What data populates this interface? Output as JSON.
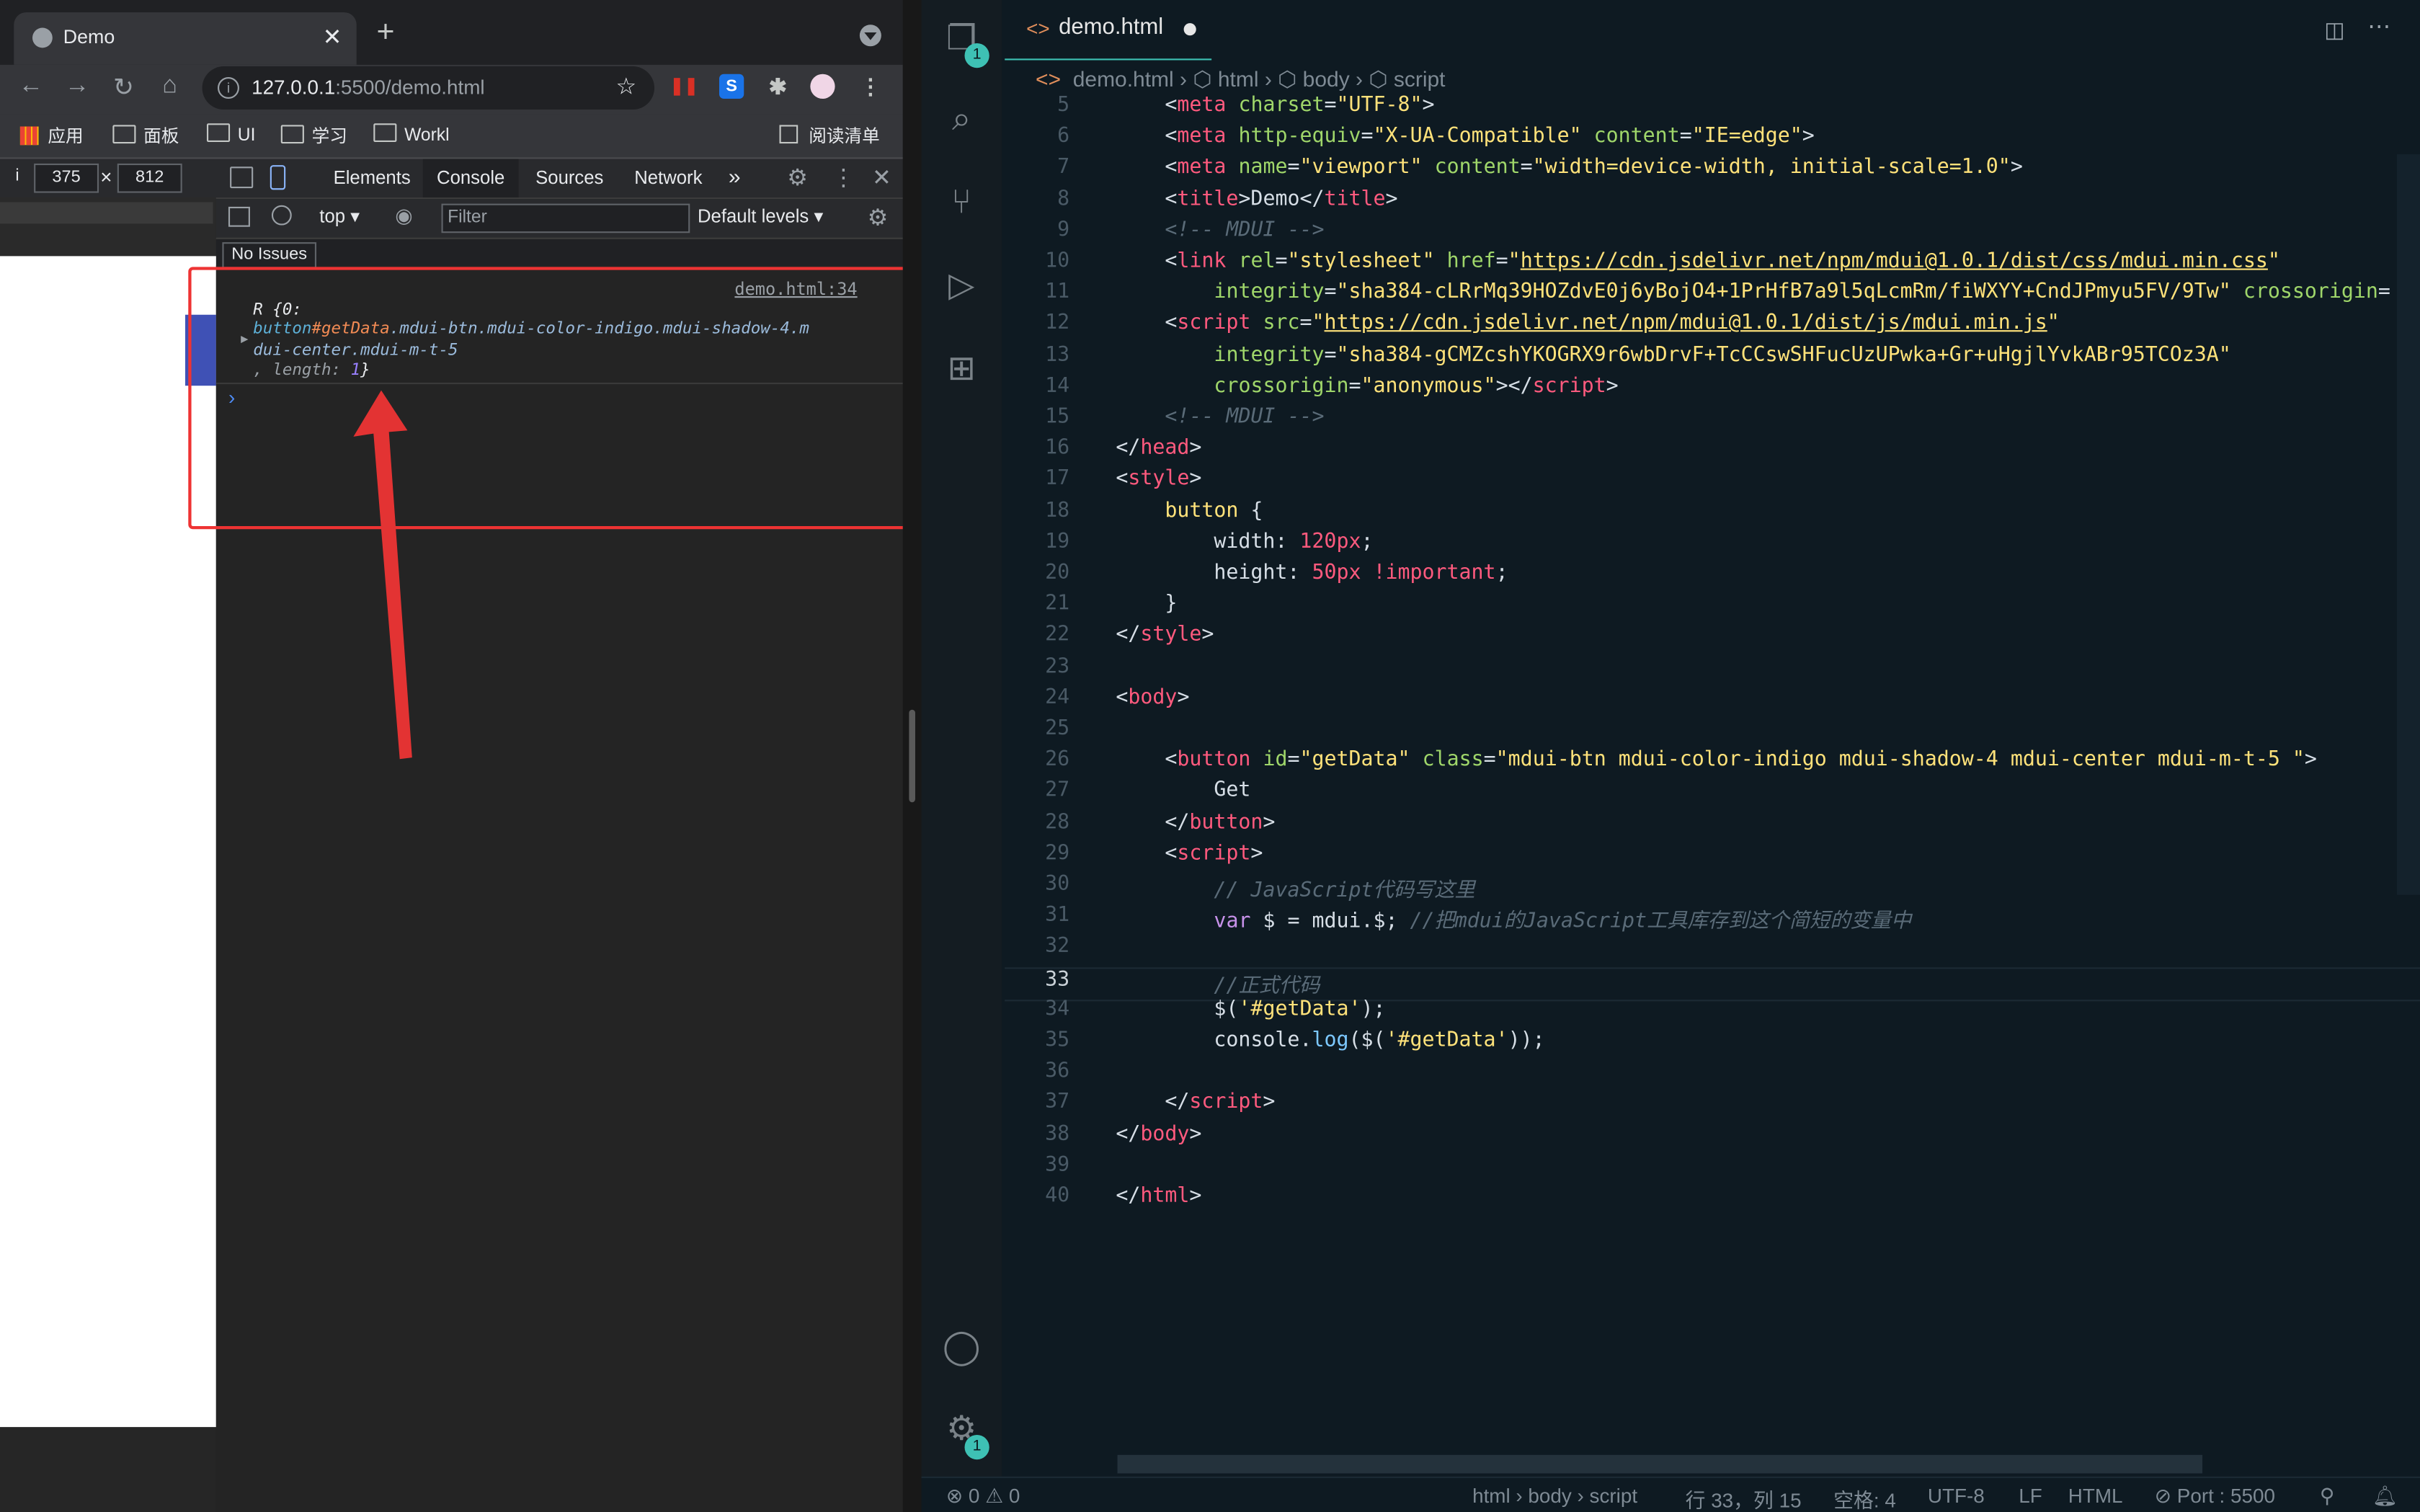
{
  "browser": {
    "tab_title": "Demo",
    "tab_close": "✕",
    "new_tab": "+",
    "url_host": "127.0.0.1",
    "url_rest": ":5500/demo.html",
    "bookmarks": [
      "应用",
      "面板",
      "UI",
      "学习",
      "Workl"
    ],
    "reading_list": "阅读清单"
  },
  "devtools": {
    "device_prefix": "i",
    "width": "375",
    "times": "×",
    "height": "812",
    "tabs": [
      "Elements",
      "Console",
      "Sources",
      "Network"
    ],
    "more": "»",
    "context": "top",
    "filter_placeholder": "Filter",
    "levels": "Default levels",
    "no_issues": "No Issues",
    "log_source": "demo.html:34",
    "log_line1": "R {0:",
    "log_selector_tag": "button",
    "log_selector_id": "#getData",
    "log_selector_cls": ".mdui-btn.mdui-color-indigo.mdui-shadow-4.m",
    "log_selector_cls2": "dui-center.mdui-m-t-5",
    "log_len_pre": ", length: ",
    "log_len_val": "1",
    "log_len_post": "}",
    "prompt": "›"
  },
  "vscode": {
    "tab_name": "demo.html",
    "breadcrumb": [
      "demo.html",
      "html",
      "body",
      "script"
    ],
    "explorer_badge": "1",
    "settings_badge": "1",
    "status": {
      "errors": "0",
      "warnings": "0",
      "path": "html › body › script",
      "position": "行 33，列 15",
      "spaces": "空格: 4",
      "encoding": "UTF-8",
      "eol": "LF",
      "language": "HTML",
      "port": "Port : 5500"
    }
  },
  "colors": {
    "accent_teal": "#3ec1b4",
    "annotation_red": "#e33333",
    "mdui_indigo": "#3f51b5"
  }
}
